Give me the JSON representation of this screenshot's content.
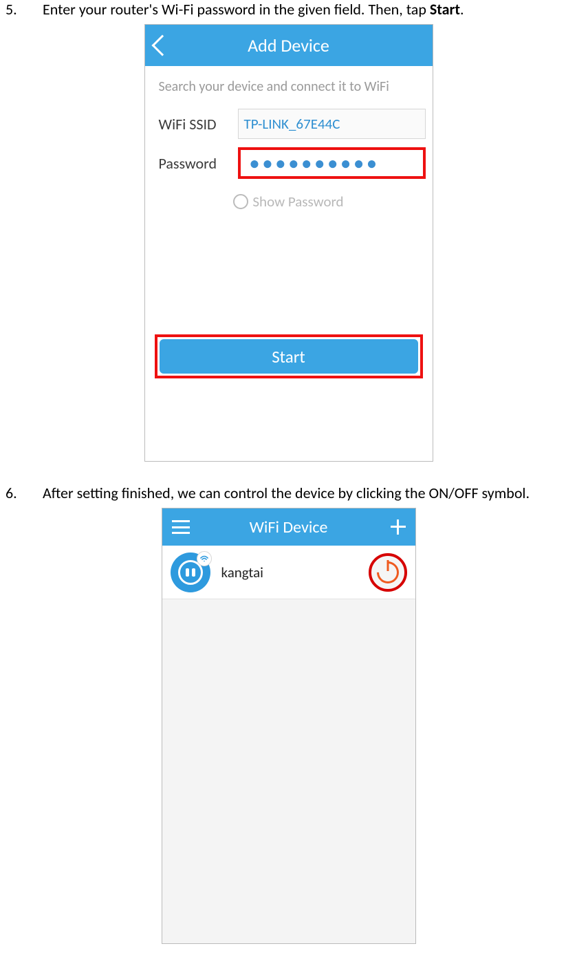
{
  "steps": {
    "s5": {
      "num": "5.",
      "text_before": "Enter your router's Wi-Fi password in the given field. Then, tap ",
      "text_bold": "Start",
      "text_after": "."
    },
    "s6": {
      "num": "6.",
      "text": "After setting finished, we can control the device by clicking the ON/OFF symbol."
    }
  },
  "screen1": {
    "title": "Add Device",
    "hint": "Search your device and connect it to WiFi",
    "ssid_label": "WiFi SSID",
    "ssid_value": "TP-LINK_67E44C",
    "pwd_label": "Password",
    "pwd_mask": "••••••••••",
    "show_pwd": "Show Password",
    "start": "Start"
  },
  "screen2": {
    "title": "WiFi Device",
    "device_name": "kangtai"
  }
}
